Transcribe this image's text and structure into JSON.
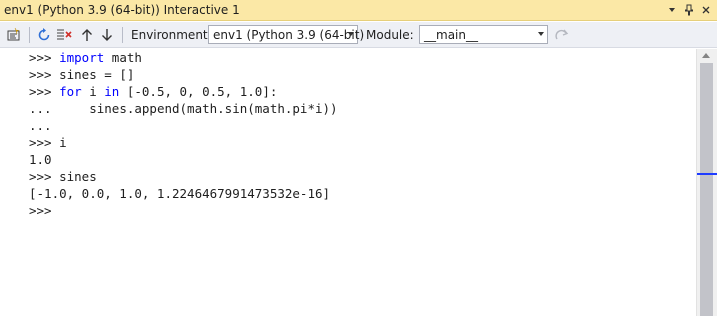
{
  "window": {
    "title": "env1 (Python 3.9 (64-bit)) Interactive 1",
    "title_buttons": [
      "dropdown-icon",
      "pin-icon",
      "close-icon"
    ]
  },
  "toolbar": {
    "buttons": [
      "reset-icon",
      "restart-icon",
      "clear-icon",
      "history-up-icon",
      "history-down-icon",
      "redo-icon"
    ],
    "environment_label": "Environment:",
    "environment_value": "env1 (Python 3.9 (64-bit)",
    "module_label": "Module:",
    "module_value": "__main__"
  },
  "repl": {
    "lines": [
      {
        "prompt": ">>> ",
        "segments": [
          {
            "t": "import",
            "kw": true
          },
          {
            "t": " math",
            "kw": false
          }
        ]
      },
      {
        "prompt": ">>> ",
        "segments": [
          {
            "t": "sines = []",
            "kw": false
          }
        ]
      },
      {
        "prompt": ">>> ",
        "segments": [
          {
            "t": "for",
            "kw": true
          },
          {
            "t": " i ",
            "kw": false
          },
          {
            "t": "in",
            "kw": true
          },
          {
            "t": " [-0.5, 0, 0.5, 1.0]:",
            "kw": false
          }
        ]
      },
      {
        "prompt": "...     ",
        "segments": [
          {
            "t": "sines.append(math.sin(math.pi*i))",
            "kw": false
          }
        ]
      },
      {
        "prompt": "...",
        "segments": []
      },
      {
        "prompt": ">>> ",
        "segments": [
          {
            "t": "i",
            "kw": false
          }
        ]
      },
      {
        "prompt": "",
        "segments": [
          {
            "t": "1.0",
            "kw": false
          }
        ]
      },
      {
        "prompt": ">>> ",
        "segments": [
          {
            "t": "sines",
            "kw": false
          }
        ]
      },
      {
        "prompt": "",
        "segments": [
          {
            "t": "[-1.0, 0.0, 1.0, 1.2246467991473532e-16]",
            "kw": false
          }
        ]
      },
      {
        "prompt": ">>>",
        "segments": []
      }
    ]
  },
  "colors": {
    "title_bg": "#fbe8a6",
    "toolbar_bg": "#eef0f5",
    "keyword": "#0000ff",
    "scroll_marker": "#1e3cff"
  }
}
